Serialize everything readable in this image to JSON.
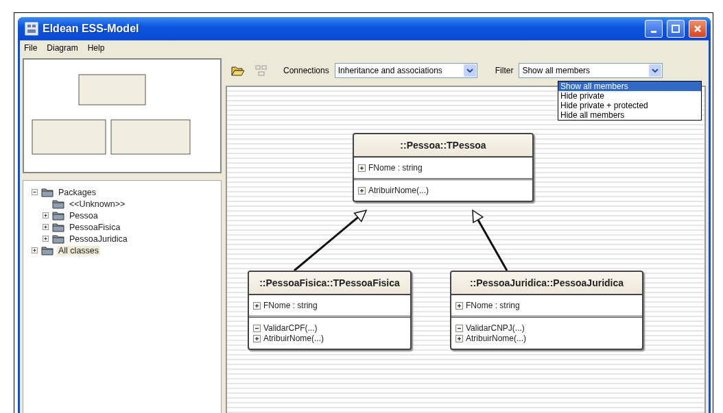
{
  "window": {
    "title": "Eldean ESS-Model"
  },
  "menu": [
    {
      "label": "File"
    },
    {
      "label": "Diagram"
    },
    {
      "label": "Help"
    }
  ],
  "toolbar": {
    "connections_label": "Connections",
    "connections_value": "Inheritance and associations",
    "filter_label": "Filter",
    "filter_value": "Show all members",
    "filter_options": [
      {
        "label": "Show all members",
        "selected": true
      },
      {
        "label": "Hide private",
        "selected": false
      },
      {
        "label": "Hide private + protected",
        "selected": false
      },
      {
        "label": "Hide all members",
        "selected": false
      }
    ]
  },
  "tree": [
    {
      "label": "Packages",
      "expanded": true,
      "selected": false,
      "children": [
        {
          "label": "<<Unknown>>",
          "selected": false
        },
        {
          "label": "Pessoa",
          "expanded": false,
          "selected": false
        },
        {
          "label": "PessoaFisica",
          "expanded": false,
          "selected": false
        },
        {
          "label": "PessoaJuridica",
          "expanded": false,
          "selected": false
        }
      ]
    },
    {
      "label": "All classes",
      "expanded": false,
      "selected": true
    }
  ],
  "classes": [
    {
      "name": "::Pessoa::TPessoa",
      "attributes": [
        {
          "text": "FNome : string",
          "expanded": false
        }
      ],
      "operations": [
        {
          "text": "AtribuirNome(...)",
          "expanded": false
        }
      ]
    },
    {
      "name": "::PessoaFisica::TPessoaFisica",
      "attributes": [
        {
          "text": "FNome : string",
          "expanded": false
        }
      ],
      "operations": [
        {
          "text": "ValidarCPF(...)",
          "expanded": true
        },
        {
          "text": "AtribuirNome(...)",
          "expanded": false
        }
      ]
    },
    {
      "name": "::PessoaJuridica::PessoaJuridica",
      "attributes": [
        {
          "text": "FNome : string",
          "expanded": false
        }
      ],
      "operations": [
        {
          "text": "ValidarCNPJ(...)",
          "expanded": true
        },
        {
          "text": "AtribuirNome(...)",
          "expanded": false
        }
      ]
    }
  ]
}
